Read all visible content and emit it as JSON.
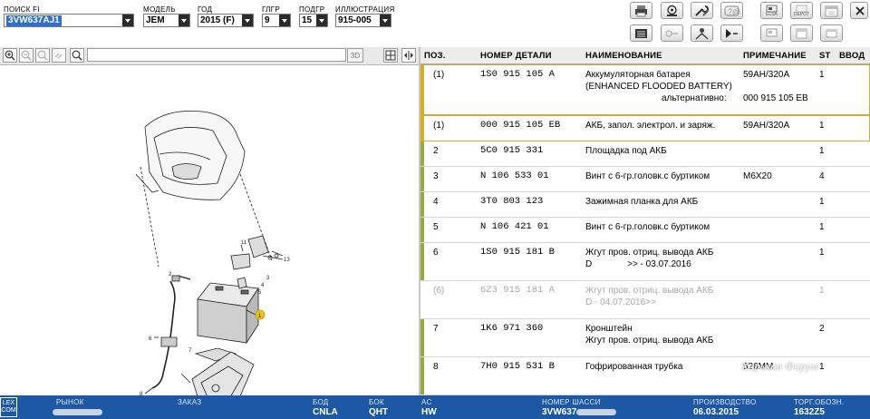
{
  "header": {
    "search": {
      "label": "ПОИСК FI",
      "value": "3VW637AJ1"
    },
    "model": {
      "label": "МОДЕЛЬ",
      "value": "JEM"
    },
    "year": {
      "label": "ГОД",
      "value": "2015 (F)"
    },
    "glgr": {
      "label": "ГЛГР",
      "value": "9"
    },
    "podgr": {
      "label": "ПОДГР",
      "value": "15"
    },
    "illustration": {
      "label": "ИЛЛЮСТРАЦИЯ",
      "value": "915-005"
    },
    "toolbar": {
      "elsa_label": "ELSA",
      "depot_label": "DEPOT",
      "icons": [
        "printer-icon",
        "stamp-icon",
        "wrench-key-icon",
        "help-icon",
        "elsa-icon",
        "depot-icon",
        "calendar-icon",
        "close-icon",
        "parts-list-icon",
        "key-icon",
        "person-tree-icon",
        "play-step-icon",
        "window-icon",
        "calendar-small-icon",
        "window-small-icon"
      ]
    }
  },
  "viewer_toolbar": {
    "btn_3d": "3D",
    "icons": [
      "zoom-in-icon",
      "zoom-out-icon",
      "zoom-fit-icon",
      "link-icon",
      "search-icon",
      "layout-icon",
      "split-icon"
    ]
  },
  "illustration_callouts": [
    "1",
    "2",
    "3",
    "4",
    "5",
    "6",
    "7",
    "8",
    "11",
    "13"
  ],
  "table": {
    "headers": {
      "pos": "ПОЗ.",
      "part_number": "НОМЕР ДЕТАЛИ",
      "name": "НАИМЕНОВАНИЕ",
      "note": "ПРИМЕЧАНИЕ",
      "qty": "ST",
      "input": "ВВОД"
    },
    "rows": [
      {
        "pos": "(1)",
        "part": "1S0  915  105  A",
        "name1": "Аккумуляторная батарея",
        "name2": "(ENHANCED FLOODED BATTERY)",
        "alt_label": "альтернативно:",
        "alt_value": "000 915 105 EB",
        "note": "59AH/320A",
        "qty": "1"
      },
      {
        "pos": "(1)",
        "part": "000  915  105  EB",
        "name1": "АКБ, запол. электрол. и заряж.",
        "note": "59AH/320A",
        "qty": "1"
      },
      {
        "pos": "2",
        "part": "5C0  915  331",
        "name1": "Площадка под АКБ",
        "note": "",
        "qty": "1"
      },
      {
        "pos": "3",
        "part": "N     106  533  01",
        "name1": "Винт с 6-гр.головк.с буртиком",
        "note": "M6X20",
        "qty": "4"
      },
      {
        "pos": "4",
        "part": "3T0  803  123",
        "name1": "Зажимная планка для АКБ",
        "note": "",
        "qty": "1"
      },
      {
        "pos": "5",
        "part": "N     106  421  01",
        "name1": "Винт с 6-гр.головк.с буртиком",
        "note": "",
        "qty": "1"
      },
      {
        "pos": "6",
        "part": "1S0  915  181  B",
        "name1": "Жгут пров. отриц. вывода АКБ",
        "name2": "D              >> - 03.07.2016",
        "note": "",
        "qty": "1"
      },
      {
        "pos": "(6)",
        "part": "6Z3  915  181  A",
        "name1": "Жгут пров. отриц. вывода АКБ",
        "name2": "D - 04.07.2016>>",
        "note": "",
        "qty": "1"
      },
      {
        "pos": "7",
        "part": "1K6  971  360",
        "name1": "Кронштейн",
        "name2": "Жгут пров. отриц. вывода АКБ",
        "note": "",
        "qty": "2"
      },
      {
        "pos": "8",
        "part": "7H0  915  531  B",
        "name1": "Гофрированная трубка",
        "note": "526MM",
        "qty": "1"
      }
    ]
  },
  "watermark": "Харьков Форум",
  "footer": {
    "logo": "LEX COM",
    "market": {
      "label": "РЫНОК",
      "value": ""
    },
    "order": {
      "label": "ЗАКАЗ",
      "value": ""
    },
    "bod": {
      "label": "БОД",
      "value": "CNLA"
    },
    "bok": {
      "label": "БОК",
      "value": "QHT"
    },
    "ac": {
      "label": "АС",
      "value": "HW"
    },
    "chassis": {
      "label": "НОМЕР ШАССИ",
      "value": "3VW637"
    },
    "production": {
      "label": "ПРОИЗВОДСТВО",
      "value": "06.03.2015"
    },
    "trade": {
      "label": "ТОРГ.ОБОЗН.",
      "value": "1632Z5"
    }
  }
}
